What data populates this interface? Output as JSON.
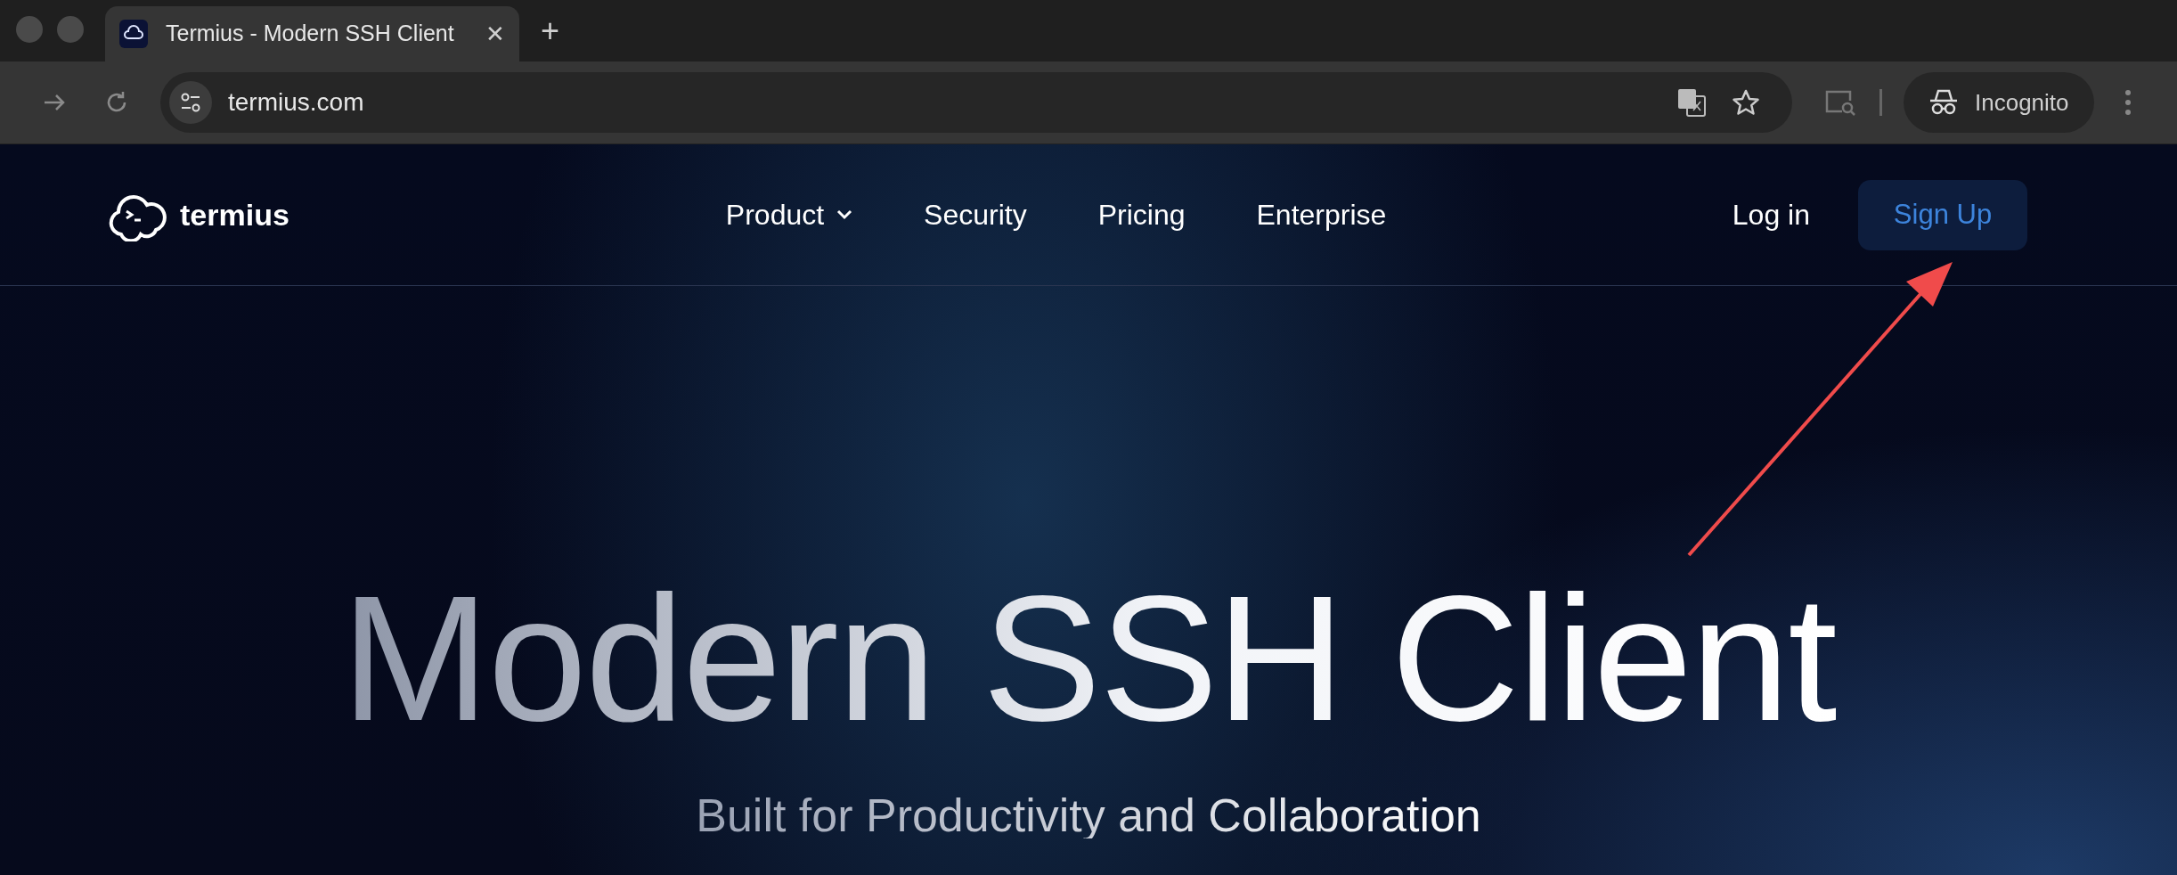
{
  "browser": {
    "tab": {
      "title": "Termius - Modern SSH Client",
      "close": "✕"
    },
    "new_tab": "+",
    "url": "termius.com",
    "profile": "Incognito"
  },
  "nav": {
    "logo": "termius",
    "items": [
      {
        "label": "Product",
        "dropdown": true
      },
      {
        "label": "Security",
        "dropdown": false
      },
      {
        "label": "Pricing",
        "dropdown": false
      },
      {
        "label": "Enterprise",
        "dropdown": false
      }
    ],
    "login": "Log in",
    "signup": "Sign Up"
  },
  "hero": {
    "title": "Modern SSH Client",
    "subtitle": "Built for Productivity and Collaboration"
  }
}
